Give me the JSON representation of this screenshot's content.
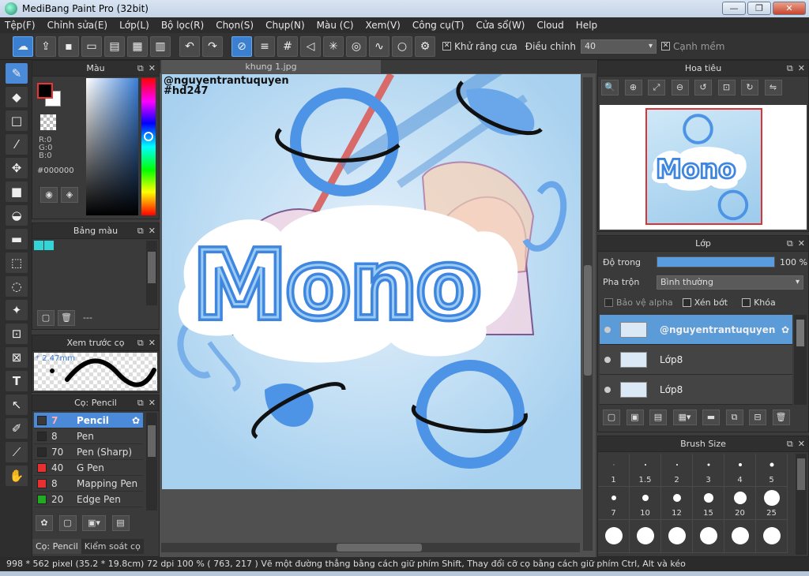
{
  "window": {
    "title": "MediBang Paint Pro (32bit)",
    "btn_min": "—",
    "btn_max": "❐",
    "btn_close": "✕"
  },
  "menu": [
    "Tệp(F)",
    "Chỉnh sửa(E)",
    "Lớp(L)",
    "Bộ lọc(R)",
    "Chọn(S)",
    "Chụp(N)",
    "Màu (C)",
    "Xem(V)",
    "Công cụ(T)",
    "Cửa sổ(W)",
    "Cloud",
    "Help"
  ],
  "toolbar": {
    "antialias_label": "Khử răng cưa",
    "adjust_label": "Điều chỉnh",
    "adjust_value": "40",
    "edge_label": "Cạnh mềm"
  },
  "color_panel": {
    "title": "Màu",
    "r": "R:0",
    "g": "G:0",
    "b": "B:0",
    "hex": "#000000",
    "fg_color": "#000000",
    "bg_color": "#ffffff"
  },
  "palette_panel": {
    "title": "Bảng màu",
    "dash": "---",
    "swatches": [
      "#33d6d6",
      "#33d6d6"
    ]
  },
  "preview_panel": {
    "title": "Xem trước cọ",
    "size": "2.47mm"
  },
  "brush_panel": {
    "title": "Cọ: Pencil",
    "items": [
      {
        "num": "7",
        "name": "Pencil",
        "color": "#3a3a3a",
        "selected": true
      },
      {
        "num": "8",
        "name": "Pen",
        "color": "#2a2a2a"
      },
      {
        "num": "70",
        "name": "Pen (Sharp)",
        "color": "#2a2a2a"
      },
      {
        "num": "40",
        "name": "G Pen",
        "color": "#e83030"
      },
      {
        "num": "8",
        "name": "Mapping Pen",
        "color": "#e83030"
      },
      {
        "num": "20",
        "name": "Edge Pen",
        "color": "#22aa22"
      }
    ],
    "tab1": "Cọ: Pencil",
    "tab2": "Kiểm soát cọ"
  },
  "canvas": {
    "tab": "khung 1.jpg",
    "watermark_line1": "@nguyentrantuquyen",
    "watermark_line2": "#hd247",
    "art_text": "Mono"
  },
  "navigator": {
    "title": "Hoa tiêu"
  },
  "layer_panel": {
    "title": "Lớp",
    "opacity_label": "Độ trong",
    "opacity_value": "100 %",
    "opacity_percent": 100,
    "blend_label": "Pha trộn",
    "blend_value": "Bình thường",
    "protect_alpha": "Bảo vệ alpha",
    "clip": "Xén bớt",
    "lock": "Khóa",
    "layers": [
      {
        "name": "@nguyentrantuquyen",
        "selected": true
      },
      {
        "name": "Lớp8"
      },
      {
        "name": "Lớp8"
      }
    ]
  },
  "brush_size_panel": {
    "title": "Brush Size",
    "sizes": [
      "1",
      "1.5",
      "2",
      "3",
      "4",
      "5",
      "7",
      "10",
      "12",
      "15",
      "20",
      "25",
      "",
      "",
      "",
      "",
      "",
      ""
    ]
  },
  "status": {
    "text": "998 * 562 pixel  (35.2 * 19.8cm)  72 dpi  100 %  ( 763, 217 )  Vẽ một đường thẳng bằng cách giữ phím Shift, Thay đổi cỡ cọ bằng cách giữ phím Ctrl, Alt và kéo"
  }
}
